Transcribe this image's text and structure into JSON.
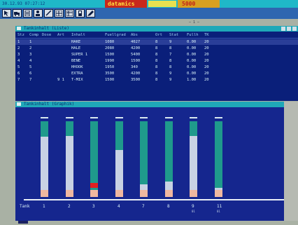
{
  "topbar": {
    "clock": "30.12.93  07:27:12",
    "brand": "datamics",
    "model": "5000"
  },
  "toolbar": {
    "icons": [
      "cursor-icon",
      "truck-icon",
      "document-icon",
      "user-icon",
      "pen-icon",
      "grid-icon",
      "table-icon",
      "tank-icon",
      "edit-icon"
    ]
  },
  "gap_mark": "— 1 —",
  "table_window": {
    "title": "Tankinhalt (Liste)",
    "columns": [
      "Stz",
      "Comp",
      "Dose",
      "Art",
      "Inhalt",
      "Fuellgrad",
      "Abs",
      "Ort",
      "Stat",
      "Fullh",
      "TK"
    ],
    "rows": [
      [
        "1",
        "1",
        "",
        "",
        "HAKE",
        "1080",
        "4027",
        "8",
        "9",
        "0.00",
        "20"
      ],
      [
        "2",
        "2",
        "",
        "",
        "HALE",
        "2080",
        "4200",
        "8",
        "8",
        "0.00",
        "20"
      ],
      [
        "3",
        "3",
        "",
        "",
        "SUPER 1",
        "1500",
        "5400",
        "8",
        "7",
        "0.00",
        "20"
      ],
      [
        "4",
        "4",
        "",
        "",
        "BENE",
        "1990",
        "1500",
        "8",
        "8",
        "0.00",
        "20"
      ],
      [
        "5",
        "5",
        "",
        "",
        "HHOOK",
        "1950",
        "340",
        "8",
        "8",
        "0.00",
        "20"
      ],
      [
        "6",
        "6",
        "",
        "",
        "EXTRA",
        "3500",
        "4200",
        "8",
        "9",
        "0.00",
        "20"
      ],
      [
        "7",
        "7",
        "",
        "9 1",
        "T-MIX",
        "1500",
        "3500",
        "8",
        "9",
        "1.00",
        "20"
      ]
    ]
  },
  "graph_window": {
    "title": "Tankinhalt (Graphik)",
    "x_prefix": "Tank",
    "bars": [
      {
        "label": "1",
        "sub": "",
        "level": 0.8,
        "alarm": false
      },
      {
        "label": "2",
        "sub": "",
        "level": 0.81,
        "alarm": false
      },
      {
        "label": "3",
        "sub": "",
        "level": 0.06,
        "alarm": true
      },
      {
        "label": "4",
        "sub": "",
        "level": 0.62,
        "alarm": false
      },
      {
        "label": "7",
        "sub": "",
        "level": 0.17,
        "alarm": false
      },
      {
        "label": "8",
        "sub": "",
        "level": 0.2,
        "alarm": false
      },
      {
        "label": "9",
        "sub": "01",
        "level": 0.81,
        "alarm": false
      },
      {
        "label": "11",
        "sub": "01",
        "level": 0.12,
        "alarm": false
      }
    ]
  },
  "colors": {
    "bg": "#a9b1a4",
    "window_bg": "#0a1f7a",
    "graph_bg": "#15268e",
    "titlebar": "#1fa8b8",
    "tube": "#1f9a8c",
    "fill": "#c8d2e4",
    "alarm": "#e02020"
  }
}
